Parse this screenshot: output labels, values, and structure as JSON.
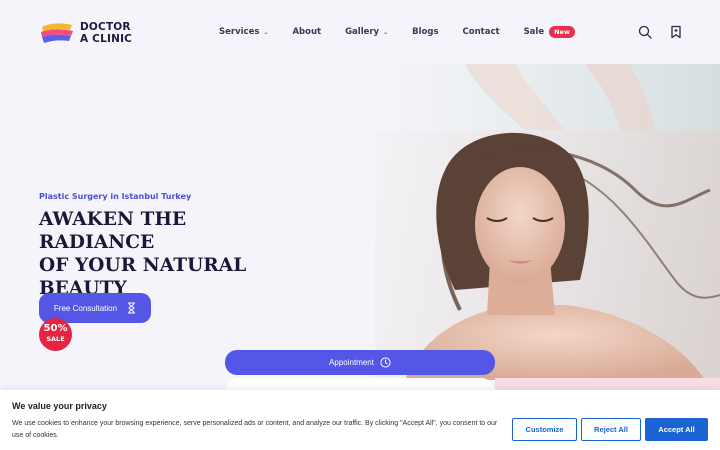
{
  "brand": {
    "line1": "DOCTOR",
    "line2": "A CLINIC"
  },
  "nav": {
    "services": "Services",
    "about": "About",
    "gallery": "Gallery",
    "blogs": "Blogs",
    "contact": "Contact",
    "sale": "Sale",
    "sale_badge": "New"
  },
  "hero": {
    "eyebrow": "Plastic Surgery in Istanbul Turkey",
    "headline_1": "AWAKEN THE RADIANCE",
    "headline_2": "OF YOUR NATURAL",
    "headline_3": "BEAUTY",
    "cta_label": "Free Consultation",
    "sale_percent": "50%",
    "sale_word": "SALE",
    "appointment_label": "Appointment"
  },
  "cookie": {
    "title": "We value your privacy",
    "text": "We use cookies to enhance your browsing experience, serve personalized ads or content, and analyze our traffic. By clicking \"Accept All\", you consent to our use of cookies.",
    "customize": "Customize",
    "reject": "Reject All",
    "accept": "Accept All"
  },
  "colors": {
    "accent": "#5457e6",
    "sale_red": "#e62442",
    "cookie_blue": "#1b63d2"
  },
  "icons": [
    "brand-logo-icon",
    "chevron-down-icon",
    "search-icon",
    "bookmark-icon",
    "hourglass-icon",
    "clock-icon"
  ]
}
